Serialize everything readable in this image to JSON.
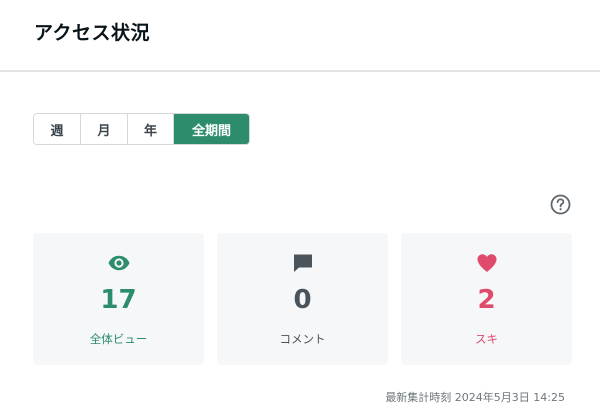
{
  "header": {
    "title": "アクセス状況"
  },
  "period_tabs": [
    {
      "label": "週",
      "active": false
    },
    {
      "label": "月",
      "active": false
    },
    {
      "label": "年",
      "active": false
    },
    {
      "label": "全期間",
      "active": true
    }
  ],
  "help": {
    "icon": "question-circle-icon"
  },
  "stats": [
    {
      "icon": "eye-icon",
      "value": "17",
      "label": "全体ビュー",
      "color": "#2c8c6c"
    },
    {
      "icon": "comment-icon",
      "value": "0",
      "label": "コメント",
      "color": "#4b545b"
    },
    {
      "icon": "heart-icon",
      "value": "2",
      "label": "スキ",
      "color": "#e04a6b"
    }
  ],
  "updated": {
    "text": "最新集計時刻 2024年5月3日 14:25"
  },
  "colors": {
    "accent": "#2c8c6c",
    "like": "#e04a6b",
    "card_bg": "#f5f7f9"
  }
}
